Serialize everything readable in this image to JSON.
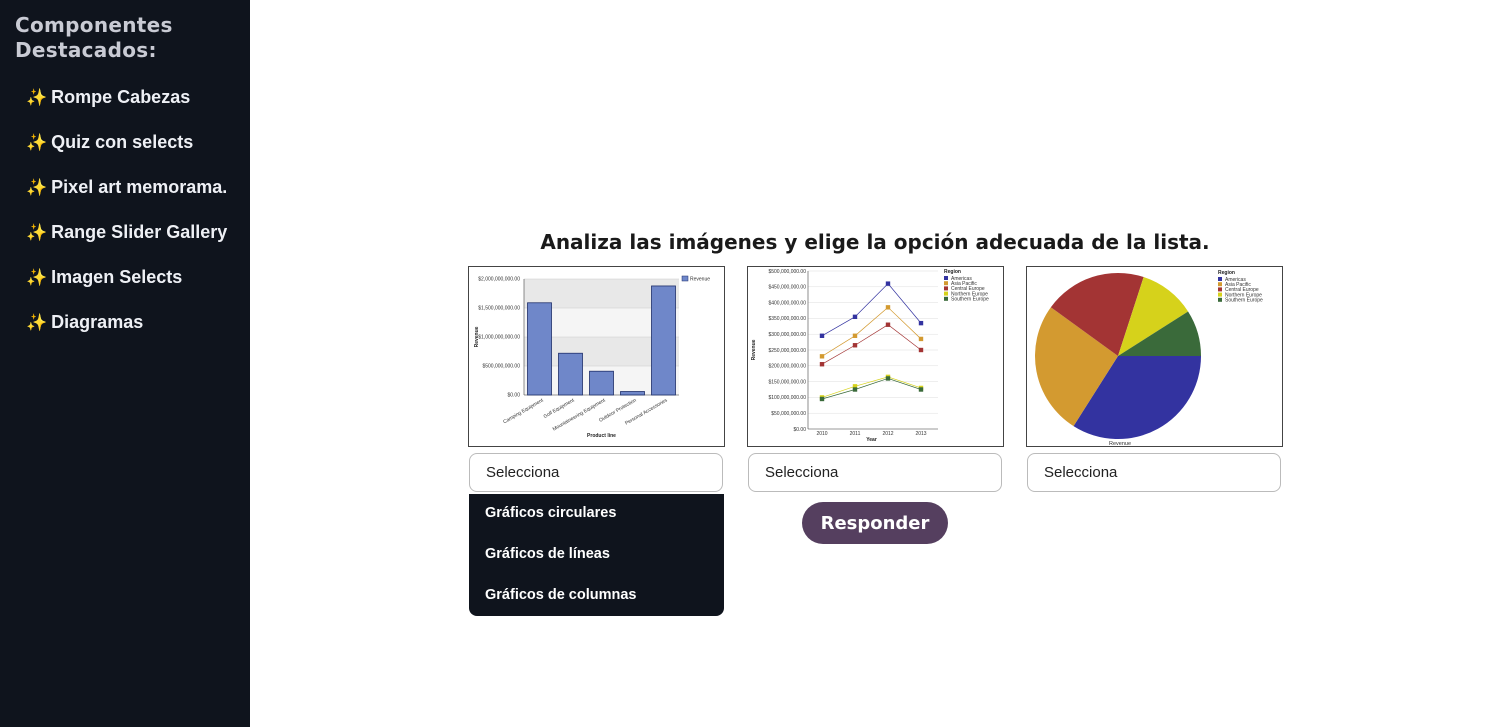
{
  "sidebar": {
    "title_line1": "Componentes",
    "title_line2": "Destacados:",
    "spark_icon": "✨",
    "items": [
      {
        "label": "Rompe Cabezas"
      },
      {
        "label": "Quiz con selects"
      },
      {
        "label": "Pixel art memorama."
      },
      {
        "label": "Range Slider Gallery"
      },
      {
        "label": "Imagen Selects"
      },
      {
        "label": "Diagramas"
      }
    ]
  },
  "main": {
    "heading": "Analiza las imágenes y elige la opción adecuada de la lista.",
    "selects": [
      {
        "value": "Selecciona"
      },
      {
        "value": "Selecciona"
      },
      {
        "value": "Selecciona"
      }
    ],
    "dropdown_options": [
      "Gráficos circulares",
      "Gráficos de líneas",
      "Gráficos de columnas"
    ],
    "respond_button": "Responder"
  },
  "chart_data": [
    {
      "type": "bar",
      "categories": [
        "Camping Equipment",
        "Golf Equipment",
        "Mountaineering Equipment",
        "Outdoor Protection",
        "Personal Accessories"
      ],
      "values": [
        1590000000,
        720000000,
        410000000,
        60000000,
        1880000000
      ],
      "xlabel": "Product line",
      "ylabel": "Revenue",
      "yticks": [
        "$0.00",
        "$500,000,000.00",
        "$1,000,000,000.00",
        "$1,500,000,000.00",
        "$2,000,000,000.00"
      ],
      "ylim": [
        0,
        2000000000
      ],
      "legend": [
        "Revenue"
      ],
      "legend_position": "top-right",
      "color": "#6f87c9"
    },
    {
      "type": "line",
      "x": [
        "2010",
        "2011",
        "2012",
        "2013"
      ],
      "xlabel": "Year",
      "ylabel": "Revenue",
      "ylim": [
        0,
        500000000
      ],
      "yticks": [
        "$0.00",
        "$50,000,000.00",
        "$100,000,000.00",
        "$150,000,000.00",
        "$200,000,000.00",
        "$250,000,000.00",
        "$300,000,000.00",
        "$350,000,000.00",
        "$400,000,000.00",
        "$450,000,000.00",
        "$500,000,000.00"
      ],
      "legend_title": "Region",
      "legend_position": "top-right",
      "series": [
        {
          "name": "Americas",
          "color": "#3333a0",
          "values": [
            295000000,
            355000000,
            460000000,
            335000000
          ]
        },
        {
          "name": "Asia Pacific",
          "color": "#d39a30",
          "values": [
            230000000,
            295000000,
            385000000,
            285000000
          ]
        },
        {
          "name": "Central Europe",
          "color": "#a33434",
          "values": [
            205000000,
            265000000,
            330000000,
            250000000
          ]
        },
        {
          "name": "Northern Europe",
          "color": "#d6d21b",
          "values": [
            100000000,
            135000000,
            165000000,
            130000000
          ]
        },
        {
          "name": "Southern Europe",
          "color": "#3a6a3a",
          "values": [
            95000000,
            125000000,
            160000000,
            125000000
          ]
        }
      ]
    },
    {
      "type": "pie",
      "xlabel": "Revenue",
      "legend_title": "Region",
      "legend_position": "top-right",
      "series": [
        {
          "name": "Americas",
          "color": "#3333a0",
          "value": 34
        },
        {
          "name": "Asia Pacific",
          "color": "#d39a30",
          "value": 26
        },
        {
          "name": "Central Europe",
          "color": "#a33434",
          "value": 20
        },
        {
          "name": "Northern Europe",
          "color": "#d6d21b",
          "value": 11
        },
        {
          "name": "Southern Europe",
          "color": "#3a6a3a",
          "value": 9
        }
      ]
    }
  ]
}
